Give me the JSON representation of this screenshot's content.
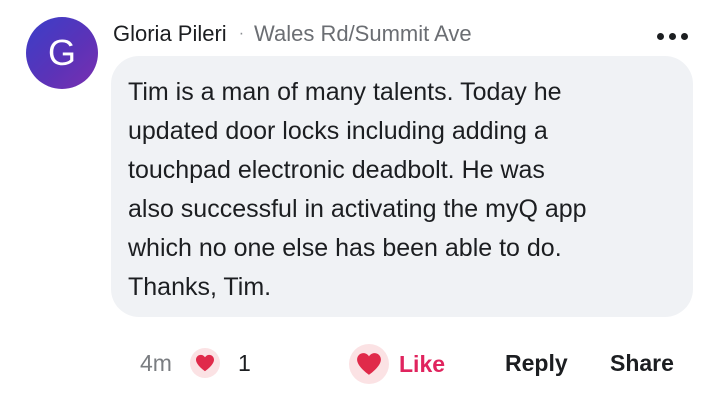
{
  "comment": {
    "avatar_letter": "G",
    "author": "Gloria Pileri",
    "separator": "·",
    "location": "Wales Rd/Summit Ave",
    "body": "Tim is a man of many talents.  Today he\nupdated door locks including adding a\ntouchpad electronic deadbolt.  He was\nalso successful in activating the  myQ app\nwhich no one else has been able to do.\nThanks, Tim.",
    "timestamp": "4m",
    "reaction_count": "1"
  },
  "actions": {
    "like_label": "Like",
    "reply_label": "Reply",
    "share_label": "Share"
  },
  "icons": {
    "more": "more-options-icon",
    "reaction": "heart-icon",
    "like": "heart-icon"
  },
  "colors": {
    "bubble": "#f0f2f5",
    "like": "#e0245e",
    "heart": "#e02a4a",
    "avatar_start": "#3a3fc9",
    "avatar_end": "#7a2fb0"
  }
}
